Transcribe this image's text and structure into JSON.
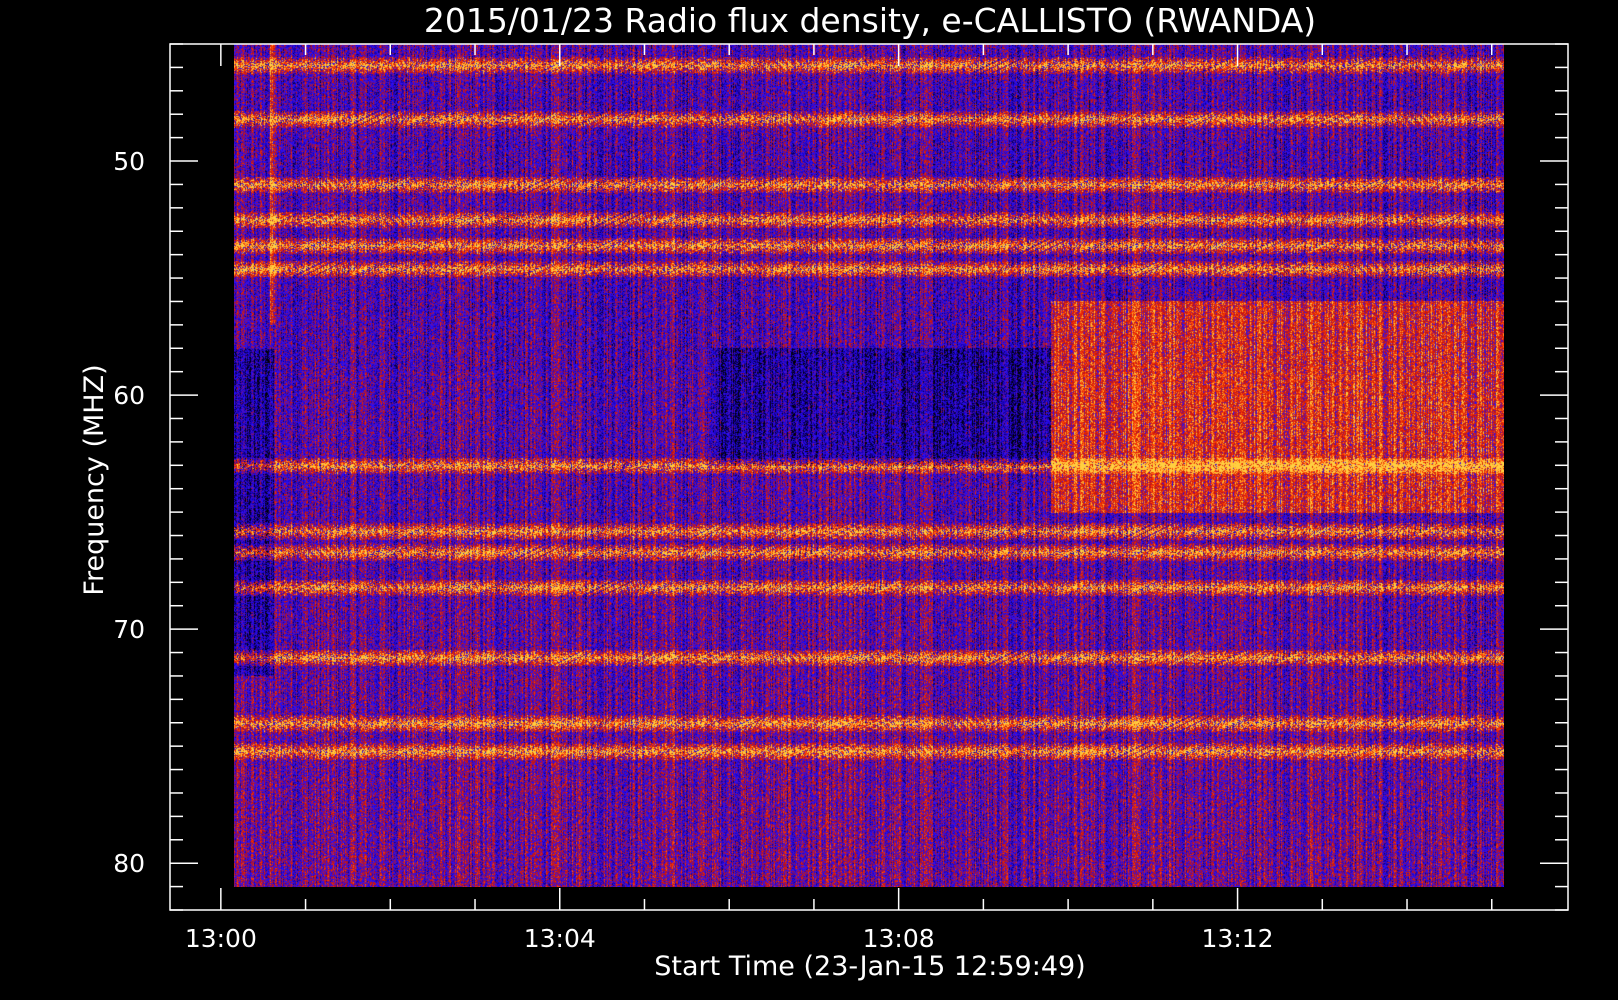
{
  "chart_data": {
    "type": "heatmap",
    "title": "2015/01/23  Radio flux density, e-CALLISTO (RWANDA)",
    "xlabel": "Start Time (23-Jan-15 12:59:49)",
    "ylabel": "Frequency (MHZ)",
    "x_ticks": [
      "13:00",
      "13:04",
      "13:08",
      "13:12"
    ],
    "x_tick_minutes": [
      0,
      4,
      8,
      12
    ],
    "x_range_minutes_after_1300": [
      -0.6,
      15.9
    ],
    "data_x_range_minutes_after_1300": [
      0.15,
      15.15
    ],
    "y_ticks": [
      50,
      60,
      70,
      80
    ],
    "y_range": [
      45,
      82
    ],
    "data_y_range": [
      45,
      81
    ],
    "y_inverted": true,
    "colormap": [
      "#000000",
      "#1a00b0",
      "#2a10ff",
      "#c01010",
      "#ff3a00",
      "#ffd040"
    ],
    "frame_color": "#ffffff",
    "background": "#000000",
    "strong_bands_mhz": [
      45.9,
      48.2,
      51.0,
      52.5,
      53.6,
      54.6,
      63.0,
      65.8,
      66.7,
      68.2,
      71.2,
      74.0,
      75.2
    ],
    "features": [
      {
        "label": "broadband emission after 13:10 (56-65 MHz)",
        "x_start_min": 9.8,
        "x_end_min": 15.15,
        "f_low": 56,
        "f_high": 65
      }
    ]
  }
}
